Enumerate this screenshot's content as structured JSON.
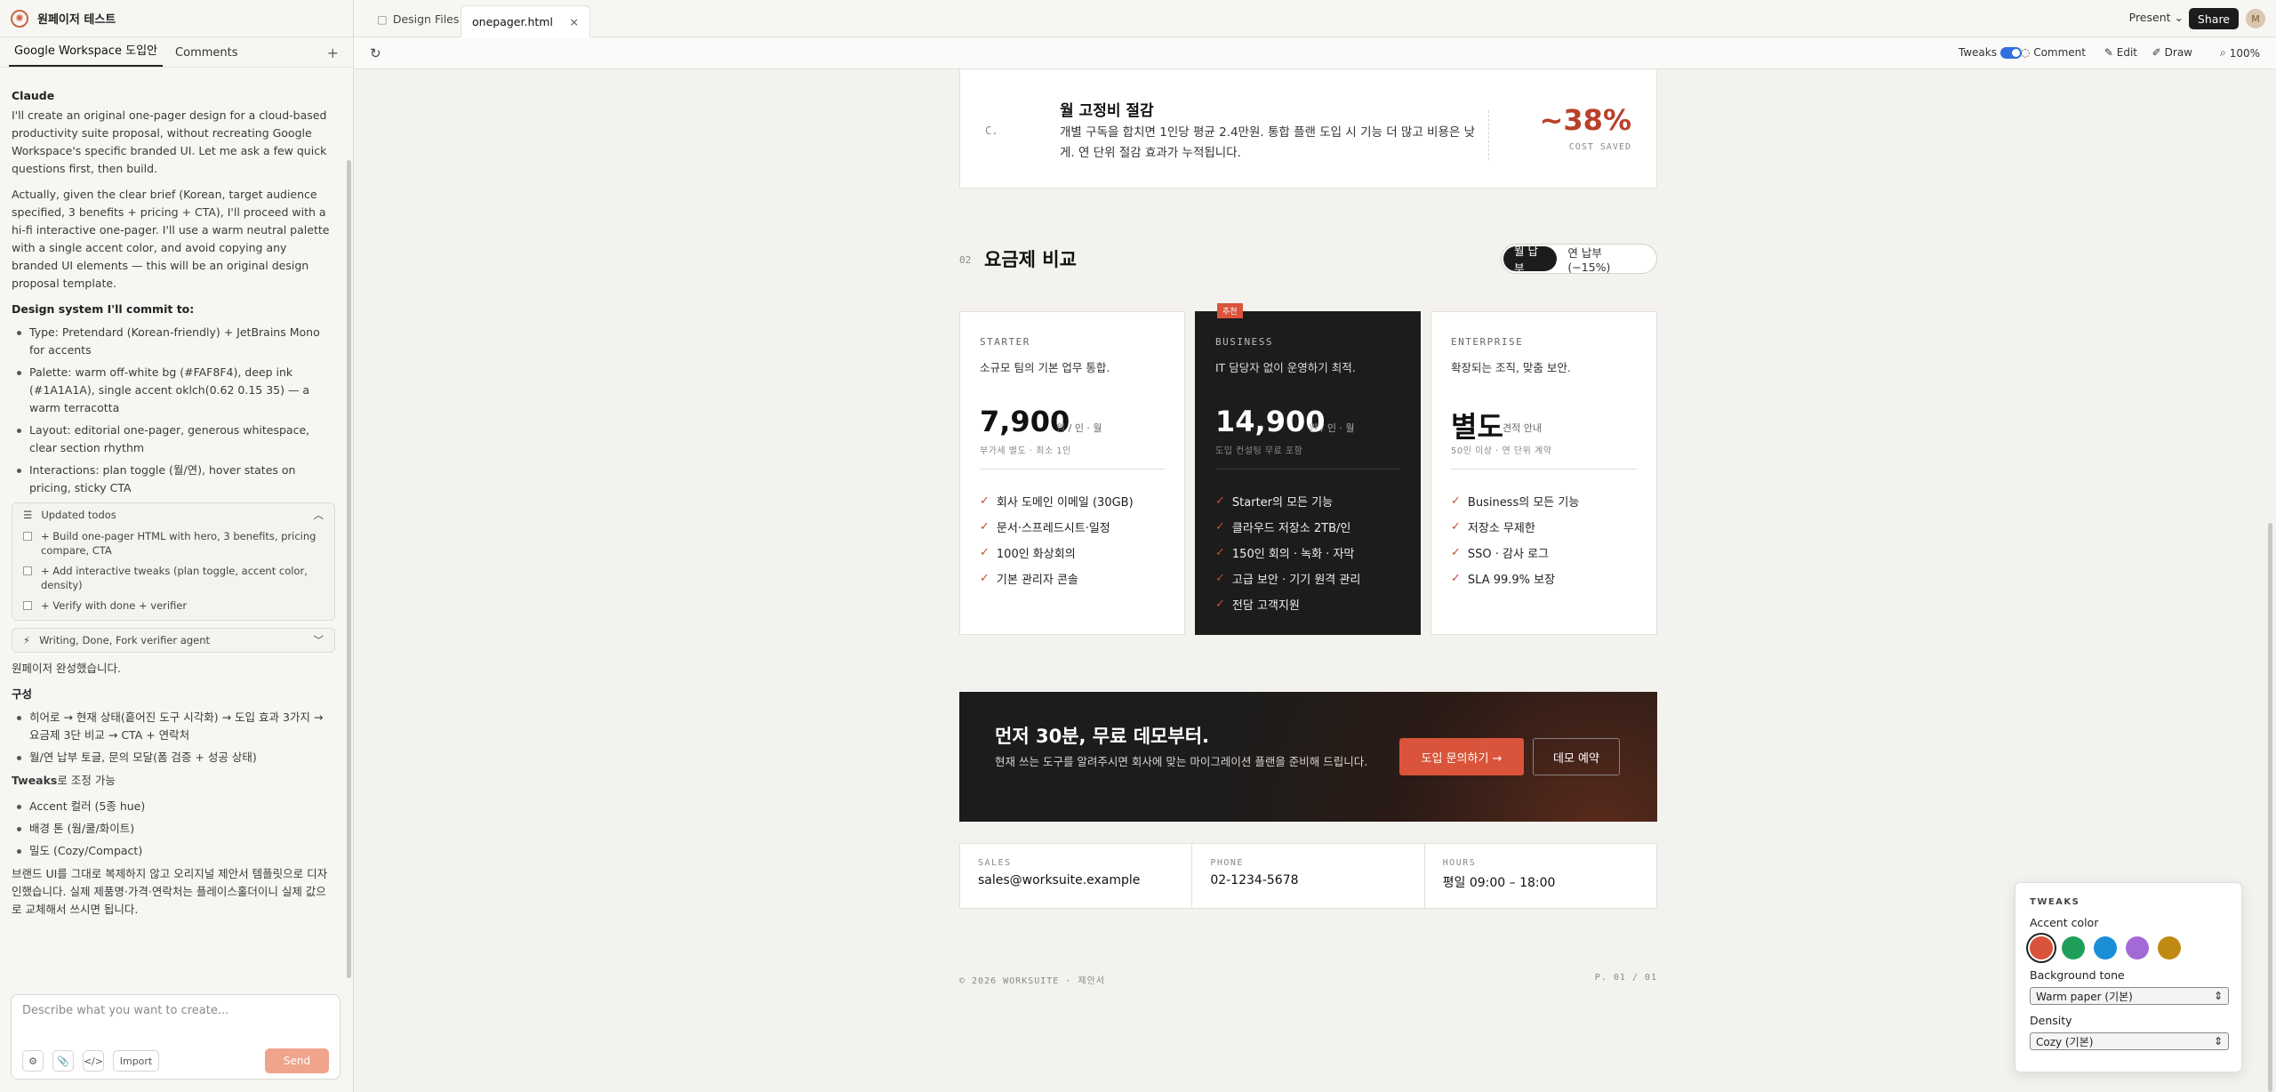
{
  "project": {
    "title": "원페이저 테스트"
  },
  "left_tabs": [
    "Google Workspace 도입안",
    "Comments"
  ],
  "chat": {
    "sender": "Claude",
    "p1": "I'll create an original one-pager design for a cloud-based productivity suite proposal, without recreating Google Workspace's specific branded UI. Let me ask a few quick questions first, then build.",
    "p2": "Actually, given the clear brief (Korean, target audience specified, 3 benefits + pricing + CTA), I'll proceed with a hi-fi interactive one-pager. I'll use a warm neutral palette with a single accent color, and avoid copying any branded UI elements — this will be an original design proposal template.",
    "design_heading": "Design system I'll commit to:",
    "design_items": [
      "Type: Pretendard (Korean-friendly) + JetBrains Mono for accents",
      "Palette: warm off-white bg (#FAF8F4), deep ink (#1A1A1A), single accent oklch(0.62 0.15 35) — a warm terracotta",
      "Layout: editorial one-pager, generous whitespace, clear section rhythm",
      "Interactions: plan toggle (월/연), hover states on pricing, sticky CTA"
    ],
    "todos_title": "Updated todos",
    "todos": [
      "+ Build one-pager HTML with hero, 3 benefits, pricing compare, CTA",
      "+ Add interactive tweaks (plan toggle, accent color, density)",
      "+ Verify with done + verifier"
    ],
    "agent_card": "Writing, Done, Fork verifier agent",
    "done_text": "원페이저 완성했습니다.",
    "composition_heading": "구성",
    "composition_items": [
      "히어로 → 현재 상태(흩어진 도구 시각화) → 도입 효과 3가지 → 요금제 3단 비교 → CTA + 연락처",
      "월/연 납부 토글, 문의 모달(폼 검증 + 성공 상태)"
    ],
    "tweaks_heading": "Tweaks",
    "tweaks_suffix": "로 조정 가능",
    "tweaks_items": [
      "Accent 컬러 (5종 hue)",
      "배경 톤 (웜/쿨/화이트)",
      "밀도 (Cozy/Compact)"
    ],
    "closing": "브랜드 UI를 그대로 복제하지 않고 오리지널 제안서 템플릿으로 디자인했습니다. 실제 제품명·가격·연락처는 플레이스홀더이니 실제 값으로 교체해서 쓰시면 됩니다."
  },
  "composer": {
    "placeholder": "Describe what you want to create...",
    "import_label": "Import",
    "send_label": "Send"
  },
  "file_tabs": [
    "Design Files",
    "onepager.html"
  ],
  "topbar": {
    "present": "Present",
    "share": "Share",
    "avatar": "M"
  },
  "toolbar": {
    "tweaks": "Tweaks",
    "comment": "Comment",
    "edit": "Edit",
    "draw": "Draw",
    "zoom": "100%"
  },
  "saving": {
    "letter": "C.",
    "title": "월 고정비 절감",
    "desc": "개별 구독을 합치면 1인당 평균 2.4만원. 통합 플랜 도입 시 기능 더 많고 비용은 낮게. 연 단위 절감 효과가 누적됩니다.",
    "value": "~38%",
    "label": "COST SAVED"
  },
  "pricing": {
    "num": "02",
    "title": "요금제 비교",
    "toggle": [
      "월 납부",
      "연 납부 (−15%)"
    ],
    "plans": [
      {
        "name": "STARTER",
        "desc": "소규모 팀의 기본 업무 통합.",
        "price": "7,900",
        "unit": "원 / 인 · 월",
        "note": "부가세 별도 · 최소 1인",
        "features": [
          "회사 도메인 이메일 (30GB)",
          "문서·스프레드시트·일정",
          "100인 화상회의",
          "기본 관리자 콘솔"
        ]
      },
      {
        "name": "BUSINESS",
        "badge": "추천",
        "desc": "IT 담당자 없이 운영하기 최적.",
        "price": "14,900",
        "unit": "원 / 인 · 월",
        "note": "도입 컨설팅 무료 포함",
        "features": [
          "Starter의 모든 기능",
          "클라우드 저장소 2TB/인",
          "150인 회의 · 녹화 · 자막",
          "고급 보안 · 기기 원격 관리",
          "전담 고객지원"
        ]
      },
      {
        "name": "ENTERPRISE",
        "desc": "확장되는 조직, 맞춤 보안.",
        "price": "별도",
        "unit": "견적 안내",
        "note": "50인 이상 · 연 단위 계약",
        "features": [
          "Business의 모든 기능",
          "저장소 무제한",
          "SSO · 감사 로그",
          "SLA 99.9% 보장"
        ]
      }
    ]
  },
  "cta": {
    "title": "먼저 30분, 무료 데모부터.",
    "desc": "현재 쓰는 도구를 알려주시면 회사에 맞는 마이그레이션 플랜을 준비해 드립니다.",
    "primary": "도입 문의하기 →",
    "secondary": "데모 예약"
  },
  "contact": [
    {
      "label": "SALES",
      "value": "sales@worksuite.example"
    },
    {
      "label": "PHONE",
      "value": "02-1234-5678"
    },
    {
      "label": "HOURS",
      "value": "평일 09:00 – 18:00"
    }
  ],
  "footer": {
    "left": "© 2026 WORKSUITE · 제안서",
    "right": "P. 01 / 01"
  },
  "tweaks_panel": {
    "title": "TWEAKS",
    "accent_label": "Accent color",
    "accent_colors": [
      "#d9543a",
      "#1f9e5a",
      "#1b8fd6",
      "#a36ad6",
      "#c08a12"
    ],
    "bg_label": "Background tone",
    "bg_value": "Warm paper (기본)",
    "density_label": "Density",
    "density_value": "Cozy (기본)"
  }
}
